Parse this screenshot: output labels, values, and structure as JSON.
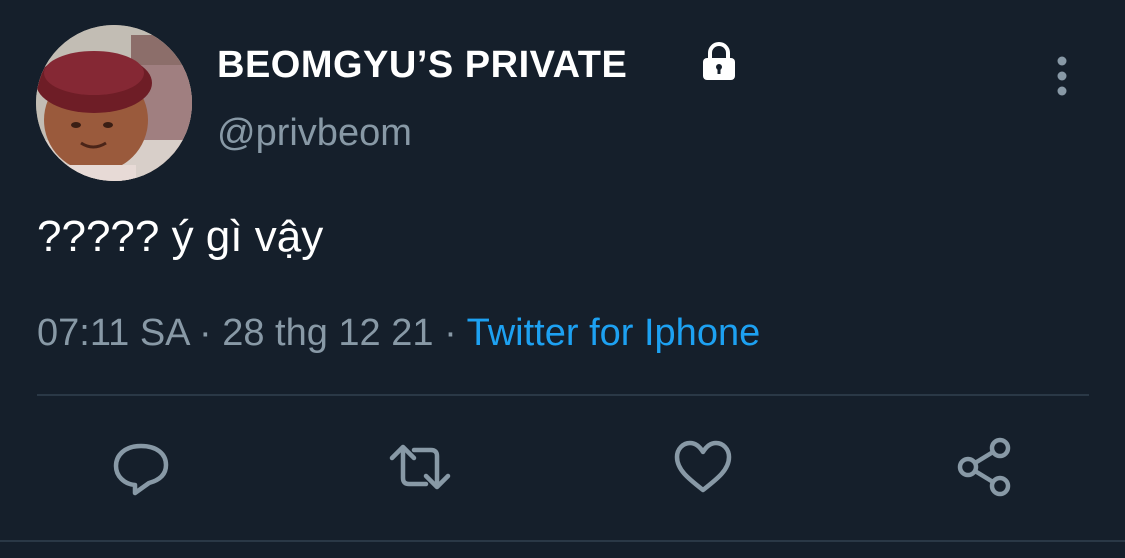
{
  "user": {
    "display_name": "BEOMGYU’S PRIVATE",
    "handle": "@privbeom",
    "protected_icon": "lock-icon",
    "avatar_description": "avatar"
  },
  "tweet": {
    "text": "????? ý gì vậy",
    "time": "07:11 SA",
    "separator": "·",
    "date": "28 thg 12 21",
    "source": "Twitter for Iphone"
  },
  "actions": {
    "reply_icon": "reply-icon",
    "retweet_icon": "retweet-icon",
    "like_icon": "heart-icon",
    "share_icon": "share-icon"
  },
  "colors": {
    "background": "#151f2b",
    "secondary_text": "#8899a6",
    "link": "#1da1f2",
    "icon": "#8899a6"
  }
}
